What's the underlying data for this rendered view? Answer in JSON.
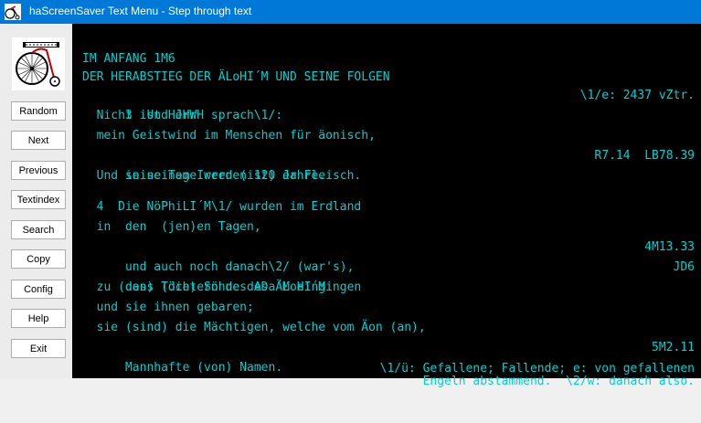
{
  "window": {
    "title": "haScreenSaver Text Menu - Step through text",
    "icon": "app-icon"
  },
  "logo": {
    "icon": "penny-farthing-bicycle-logo"
  },
  "buttons": [
    {
      "name": "random-button",
      "label": "Random"
    },
    {
      "name": "next-button",
      "label": "Next"
    },
    {
      "name": "previous-button",
      "label": "Previous"
    },
    {
      "name": "textindex-button",
      "label": "Textindex"
    },
    {
      "name": "search-button",
      "label": "Search"
    },
    {
      "name": "copy-button",
      "label": "Copy"
    },
    {
      "name": "config-button",
      "label": "Config"
    },
    {
      "name": "help-button",
      "label": "Help"
    },
    {
      "name": "exit-button",
      "label": "Exit"
    }
  ],
  "text": {
    "heading1": "IM ANFANG 1M6",
    "heading2": "DER HERABSTIEG DER ÄLoHI´M UND SEINE FOLGEN",
    "v3_line1": "  3  Und JHWH sprach\\1/:",
    "v3_line1_ref": "\\1/e: 2437 vZtr.",
    "v3_line2": "  Nicht ist Herr",
    "v3_line3": "  mein Geistwind im Menschen für äonisch,",
    "v3_line4": "  in seinem Irren (ist) er Fleisch.",
    "v3_line4_ref": "R7.14  LB78.39",
    "v3_line5": "  Und seine Tage werden 120 Jahre.",
    "v4_line1": "  4  Die NöPhiLI´M\\1/ wurden im Erdland",
    "v4_line2": "  in  den  (jen)en Tagen,",
    "v4_line3": "  und auch noch danach\\2/ (war's),",
    "v4_line3_ref": "4M13.33",
    "v4_line4": "  dass (die) Söhne des ÄLoHI´M",
    "v4_line4_ref": "JD6",
    "v4_line5": "  zu (den) Töchtern des ADa´M eingingen",
    "v4_line6": "  und sie ihnen gebaren;",
    "v4_line7": "  sie (sind) die Mächtigen, welche vom Äon (an),",
    "v4_line8": "  Mannhafte (von) Namen.",
    "v4_line8_ref": "5M2.11",
    "footnote1": "\\1/ü: Gefallene; Fallende; e: von gefallenen",
    "footnote2": "Engeln abstammend.  \\2/w: danach also."
  },
  "colors": {
    "text": "#00d0d0",
    "background": "#000000",
    "titlebar": "#0078d7"
  }
}
